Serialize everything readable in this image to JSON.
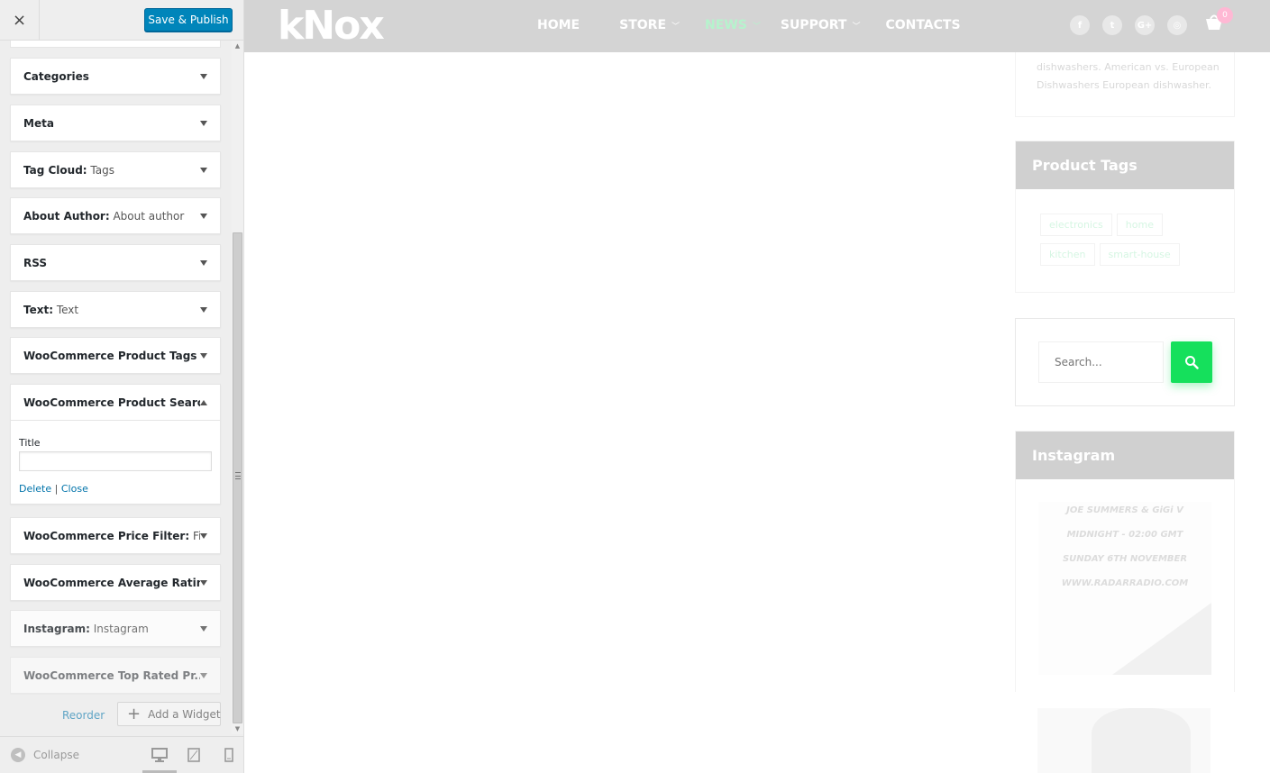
{
  "customizer": {
    "close_icon": "×",
    "save_button": "Save & Publish",
    "widgets": [
      {
        "title": "Categories",
        "subtitle": "",
        "state": "collapsed"
      },
      {
        "title": "Meta",
        "subtitle": "",
        "state": "collapsed"
      },
      {
        "title": "Tag Cloud:",
        "subtitle": " Tags",
        "state": "collapsed"
      },
      {
        "title": "About Author:",
        "subtitle": " About author",
        "state": "collapsed"
      },
      {
        "title": "RSS",
        "subtitle": "",
        "state": "collapsed"
      },
      {
        "title": "Text:",
        "subtitle": " Text",
        "state": "collapsed"
      },
      {
        "title": "WooCommerce Product Tags",
        "subtitle": "",
        "state": "collapsed"
      },
      {
        "title": "WooCommerce Product Search",
        "subtitle": "",
        "state": "expanded"
      },
      {
        "title": "WooCommerce Price Filter:",
        "subtitle": " Fil...",
        "state": "collapsed"
      },
      {
        "title": "WooCommerce Average Ratin...",
        "subtitle": "",
        "state": "collapsed"
      },
      {
        "title": "Instagram:",
        "subtitle": " Instagram",
        "state": "collapsed"
      },
      {
        "title": "WooCommerce Top Rated Pr...",
        "subtitle": "",
        "state": "collapsed"
      }
    ],
    "expanded_widget": {
      "field_label": "Title",
      "field_value": "",
      "delete_link": "Delete",
      "separator": "|",
      "close_link": "Close"
    },
    "reorder_link": "Reorder",
    "add_widget_button": "Add a Widget",
    "add_widget_icon": "plus-icon",
    "collapse_label": "Collapse",
    "devices": [
      "desktop-icon",
      "tablet-icon",
      "mobile-icon"
    ]
  },
  "site": {
    "logo_text": "kNox",
    "nav": [
      {
        "label": "HOME",
        "has_dropdown": false,
        "active": false
      },
      {
        "label": "STORE",
        "has_dropdown": true,
        "active": false
      },
      {
        "label": "NEWS",
        "has_dropdown": true,
        "active": true
      },
      {
        "label": "SUPPORT",
        "has_dropdown": true,
        "active": false
      },
      {
        "label": "CONTACTS",
        "has_dropdown": false,
        "active": false
      }
    ],
    "social": [
      {
        "icon": "facebook-icon",
        "glyph": "f"
      },
      {
        "icon": "twitter-icon",
        "glyph": "t"
      },
      {
        "icon": "google-plus-icon",
        "glyph": "G+"
      },
      {
        "icon": "instagram-icon",
        "glyph": "◎"
      }
    ],
    "cart_count": "0",
    "recent_post_text": "dishwashers. American vs. European Dishwashers European dishwasher.",
    "product_tags_title": "Product Tags",
    "tags": [
      "electronics",
      "home",
      "kitchen",
      "smart-house"
    ],
    "search_placeholder": "Search...",
    "instagram_title": "Instagram",
    "instagram_post_lines": [
      "JOE SUMMERS & GiGi V",
      "MIDNIGHT - 02:00 GMT",
      "SUNDAY 6TH NOVEMBER",
      "WWW.RADARRADIO.COM"
    ]
  },
  "colors": {
    "save_button": "#0085ba",
    "link": "#0073aa",
    "search_button": "#15e05c",
    "active_nav": "#b6f3cd",
    "header_bg": "#d4d4d4"
  }
}
